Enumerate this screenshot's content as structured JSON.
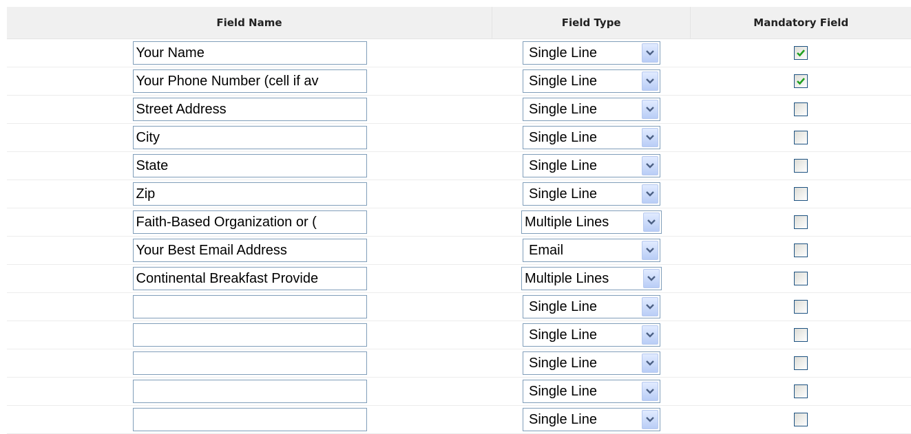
{
  "headers": {
    "field_name": "Field Name",
    "field_type": "Field Type",
    "mandatory": "Mandatory Field"
  },
  "rows": [
    {
      "name": "Your Name",
      "type": "Single Line",
      "mandatory": true
    },
    {
      "name": "Your Phone Number (cell if av",
      "type": "Single Line",
      "mandatory": true
    },
    {
      "name": "Street Address",
      "type": "Single Line",
      "mandatory": false
    },
    {
      "name": "City",
      "type": "Single Line",
      "mandatory": false
    },
    {
      "name": "State",
      "type": "Single Line",
      "mandatory": false
    },
    {
      "name": "Zip",
      "type": "Single Line",
      "mandatory": false
    },
    {
      "name": "Faith-Based Organization or (",
      "type": "Multiple Lines",
      "mandatory": false
    },
    {
      "name": "Your Best Email Address",
      "type": "Email",
      "mandatory": false
    },
    {
      "name": "Continental Breakfast Provide",
      "type": "Multiple Lines",
      "mandatory": false
    },
    {
      "name": "",
      "type": "Single Line",
      "mandatory": false
    },
    {
      "name": "",
      "type": "Single Line",
      "mandatory": false
    },
    {
      "name": "",
      "type": "Single Line",
      "mandatory": false
    },
    {
      "name": "",
      "type": "Single Line",
      "mandatory": false
    },
    {
      "name": "",
      "type": "Single Line",
      "mandatory": false
    }
  ],
  "colors": {
    "header_bg": "#f0f0f0",
    "input_border": "#7f9db9",
    "check_color": "#21a121"
  },
  "icons": {
    "dropdown": "chevron-down-icon",
    "check": "checkmark-icon"
  }
}
